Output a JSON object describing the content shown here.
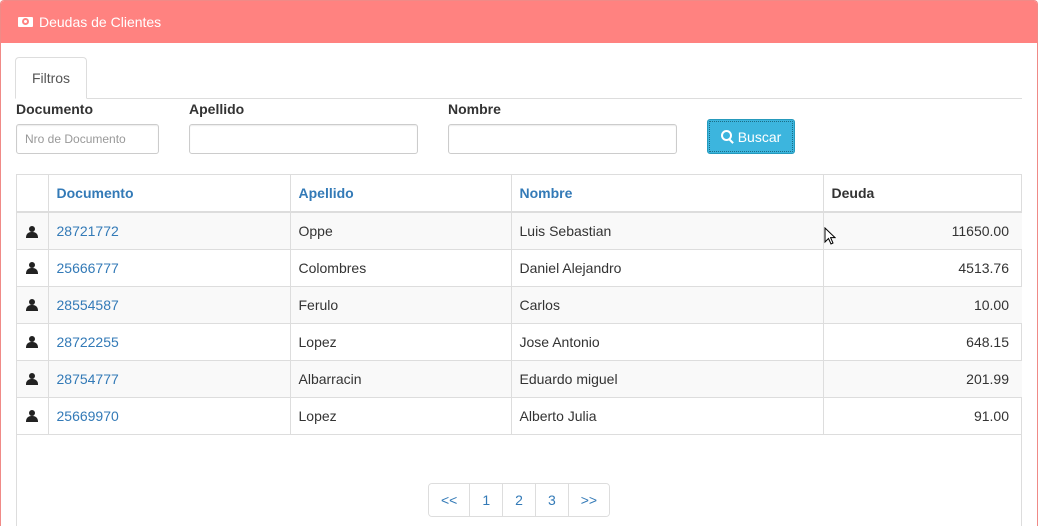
{
  "panel": {
    "title": "Deudas de Clientes"
  },
  "tabs": [
    {
      "label": "Filtros"
    }
  ],
  "filters": {
    "documento": {
      "label": "Documento",
      "placeholder": "Nro de Documento",
      "value": ""
    },
    "apellido": {
      "label": "Apellido",
      "placeholder": "",
      "value": ""
    },
    "nombre": {
      "label": "Nombre",
      "placeholder": "",
      "value": ""
    },
    "search_button": "Buscar"
  },
  "table": {
    "headers": {
      "documento": "Documento",
      "apellido": "Apellido",
      "nombre": "Nombre",
      "deuda": "Deuda"
    },
    "rows": [
      {
        "documento": "28721772",
        "apellido": "Oppe",
        "nombre": "Luis Sebastian",
        "deuda": "11650.00"
      },
      {
        "documento": "25666777",
        "apellido": "Colombres",
        "nombre": "Daniel Alejandro",
        "deuda": "4513.76"
      },
      {
        "documento": "28554587",
        "apellido": "Ferulo",
        "nombre": "Carlos",
        "deuda": "10.00"
      },
      {
        "documento": "28722255",
        "apellido": "Lopez",
        "nombre": "Jose Antonio",
        "deuda": "648.15"
      },
      {
        "documento": "28754777",
        "apellido": "Albarracin",
        "nombre": "Eduardo miguel",
        "deuda": "201.99"
      },
      {
        "documento": "25669970",
        "apellido": "Lopez",
        "nombre": "Alberto Julia",
        "deuda": "91.00"
      }
    ]
  },
  "pagination": {
    "first": "<<",
    "pages": [
      "1",
      "2",
      "3"
    ],
    "last": ">>"
  },
  "icons": {
    "heading": "money-icon",
    "row": "user-icon",
    "search": "search-icon"
  },
  "colors": {
    "heading_bg": "#ff8280",
    "button_bg": "#3cb5de",
    "link": "#337ab7"
  }
}
